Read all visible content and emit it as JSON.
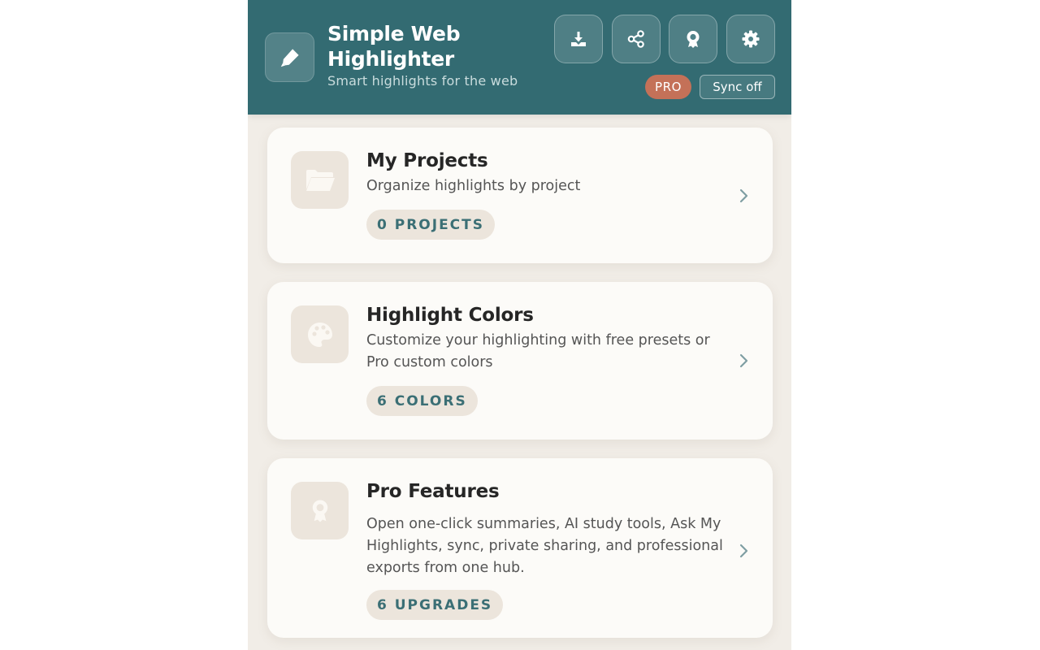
{
  "header": {
    "title": "Simple Web Highlighter",
    "subtitle": "Smart highlights for the web",
    "logo_icon": "highlighter-icon",
    "actions": [
      {
        "name": "download-button",
        "icon": "download-icon"
      },
      {
        "name": "share-button",
        "icon": "share-icon"
      },
      {
        "name": "pro-award-button",
        "icon": "award-icon"
      },
      {
        "name": "settings-button",
        "icon": "gear-icon"
      }
    ],
    "pro_label": "PRO",
    "sync_label": "Sync off"
  },
  "cards": [
    {
      "title": "My Projects",
      "description": "Organize highlights by project",
      "badge": "0 PROJECTS",
      "icon": "folder-icon"
    },
    {
      "title": "Highlight Colors",
      "description": "Customize your highlighting with free presets or Pro custom colors",
      "badge": "6 COLORS",
      "icon": "palette-icon"
    },
    {
      "title": "Pro Features",
      "description": "Open one-click summaries, AI study tools, Ask My Highlights, sync, private sharing, and professional exports from one hub.",
      "badge": "6 UPGRADES",
      "icon": "award-icon"
    }
  ],
  "colors": {
    "header_bg": "#336b72",
    "accent_pro": "#c47158",
    "badge_text": "#3b6f75",
    "panel_bg": "#f1ede7",
    "card_bg": "#fcfbf8",
    "icon_tile_bg": "#ece5dc"
  }
}
